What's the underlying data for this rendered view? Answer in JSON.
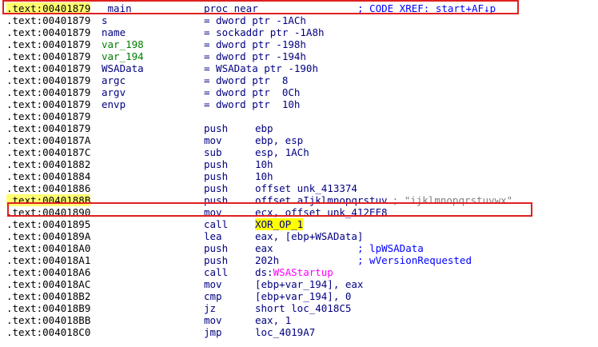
{
  "colors": {
    "text": "#000080",
    "address": "#000000",
    "comment": "#0000ff",
    "string_comment": "#808080",
    "variable": "#008000",
    "api_call": "#ff00ff",
    "highlight": "#ffff00",
    "annotation_box": "#e02020"
  },
  "lines": [
    {
      "addr": ".text:00401879",
      "label": "_main",
      "mnem": "proc near",
      "ops": "",
      "comment": "; CODE XREF: start+AF↓p"
    },
    {
      "addr": ".text:00401879",
      "label": "s",
      "mnem": "= dword ptr -1ACh",
      "ops": "",
      "comment": ""
    },
    {
      "addr": ".text:00401879",
      "label": "name",
      "mnem": "= sockaddr ptr -1A8h",
      "ops": "",
      "comment": ""
    },
    {
      "addr": ".text:00401879",
      "label": "var_198",
      "mnem": "= dword ptr -198h",
      "ops": "",
      "comment": ""
    },
    {
      "addr": ".text:00401879",
      "label": "var_194",
      "mnem": "= dword ptr -194h",
      "ops": "",
      "comment": ""
    },
    {
      "addr": ".text:00401879",
      "label": "WSAData",
      "mnem": "= WSAData ptr -190h",
      "ops": "",
      "comment": ""
    },
    {
      "addr": ".text:00401879",
      "label": "argc",
      "mnem": "= dword ptr  8",
      "ops": "",
      "comment": ""
    },
    {
      "addr": ".text:00401879",
      "label": "argv",
      "mnem": "= dword ptr  0Ch",
      "ops": "",
      "comment": ""
    },
    {
      "addr": ".text:00401879",
      "label": "envp",
      "mnem": "= dword ptr  10h",
      "ops": "",
      "comment": ""
    },
    {
      "addr": ".text:00401879",
      "label": "",
      "mnem": "",
      "ops": "",
      "comment": ""
    },
    {
      "addr": ".text:00401879",
      "label": "",
      "mnem": "push",
      "ops": "ebp",
      "comment": ""
    },
    {
      "addr": ".text:0040187A",
      "label": "",
      "mnem": "mov",
      "ops": "ebp, esp",
      "comment": ""
    },
    {
      "addr": ".text:0040187C",
      "label": "",
      "mnem": "sub",
      "ops": "esp, 1ACh",
      "comment": ""
    },
    {
      "addr": ".text:00401882",
      "label": "",
      "mnem": "push",
      "ops": "10h",
      "comment": ""
    },
    {
      "addr": ".text:00401884",
      "label": "",
      "mnem": "push",
      "ops": "10h",
      "comment": ""
    },
    {
      "addr": ".text:00401886",
      "label": "",
      "mnem": "push",
      "ops": "offset unk_413374",
      "comment": ""
    },
    {
      "addr": ".text:0040188B",
      "label": "",
      "mnem": "push",
      "ops": "offset aIjklmnopqrstuv",
      "comment": "; \"ijklmnopqrstuvwx\""
    },
    {
      "addr": ".text:00401890",
      "label": "",
      "mnem": "mov",
      "ops": "ecx, offset unk_412EF8",
      "comment": ""
    },
    {
      "addr": ".text:00401895",
      "label": "",
      "mnem": "call",
      "ops": "XOR_OP_1",
      "comment": ""
    },
    {
      "addr": ".text:0040189A",
      "label": "",
      "mnem": "lea",
      "ops": "eax, [ebp+WSAData]",
      "comment": ""
    },
    {
      "addr": ".text:004018A0",
      "label": "",
      "mnem": "push",
      "ops": "eax",
      "comment": "; lpWSAData"
    },
    {
      "addr": ".text:004018A1",
      "label": "",
      "mnem": "push",
      "ops": "202h",
      "comment": "; wVersionRequested"
    },
    {
      "addr": ".text:004018A6",
      "label": "",
      "mnem": "call",
      "ops": "ds:WSAStartup",
      "comment": ""
    },
    {
      "addr": ".text:004018AC",
      "label": "",
      "mnem": "mov",
      "ops": "[ebp+var_194], eax",
      "comment": ""
    },
    {
      "addr": ".text:004018B2",
      "label": "",
      "mnem": "cmp",
      "ops": "[ebp+var_194], 0",
      "comment": ""
    },
    {
      "addr": ".text:004018B9",
      "label": "",
      "mnem": "jz",
      "ops": "short loc_4018C5",
      "comment": ""
    },
    {
      "addr": ".text:004018BB",
      "label": "",
      "mnem": "mov",
      "ops": "eax, 1",
      "comment": ""
    },
    {
      "addr": ".text:004018C0",
      "label": "",
      "mnem": "jmp",
      "ops": "loc_4019A7",
      "comment": ""
    }
  ]
}
